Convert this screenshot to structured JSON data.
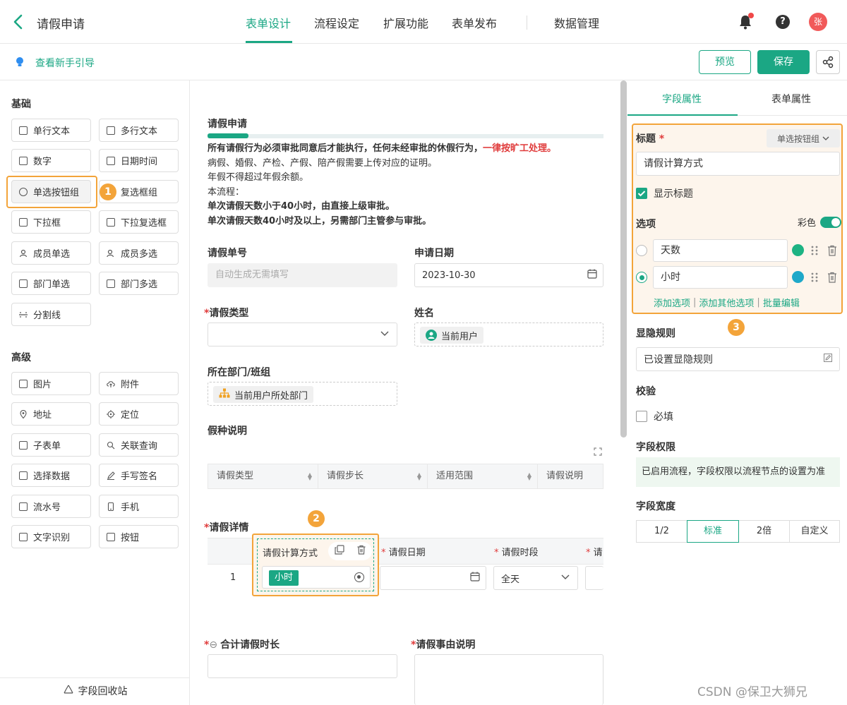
{
  "header": {
    "back_icon": "chevron-left-icon",
    "title": "请假申请",
    "nav": [
      "表单设计",
      "流程设定",
      "扩展功能",
      "表单发布",
      "数据管理"
    ],
    "active_nav": "表单设计",
    "help_label": "?",
    "avatar_label": "张"
  },
  "toolbar": {
    "guide_label": "查看新手引导",
    "preview_label": "预览",
    "save_label": "保存"
  },
  "left_panel": {
    "basic_title": "基础",
    "basic_items": [
      "单行文本",
      "多行文本",
      "数字",
      "日期时间",
      "单选按钮组",
      "复选框组",
      "下拉框",
      "下拉复选框",
      "成员单选",
      "成员多选",
      "部门单选",
      "部门多选",
      "分割线"
    ],
    "advanced_title": "高级",
    "advanced_items": [
      "图片",
      "附件",
      "地址",
      "定位",
      "子表单",
      "关联查询",
      "选择数据",
      "手写签名",
      "流水号",
      "手机",
      "文字识别",
      "按钮"
    ],
    "recycle_label": "字段回收站"
  },
  "badges": {
    "one": "1",
    "two": "2",
    "three": "3"
  },
  "form": {
    "title": "请假申请",
    "note": {
      "line1_bold": "所有请假行为必须审批同意后才能执行，任何未经审批的休假行为，",
      "line1_red": "一律按旷工处理。",
      "line2": "病假、婚假、产检、产假、陪产假需要上传对应的证明。",
      "line3": "年假不得超过年假余额。",
      "line4": "本流程：",
      "line5": "单次请假天数小于40小时，由直接上级审批。",
      "line6": "单次请假天数40小时及以上，另需部门主管参与审批。"
    },
    "order_no_label": "请假单号",
    "order_no_placeholder": "自动生成无需填写",
    "apply_date_label": "申请日期",
    "apply_date_value": "2023-10-30",
    "leave_type_label": "请假类型",
    "name_label": "姓名",
    "name_chip": "当前用户",
    "dept_label": "所在部门/班组",
    "dept_chip": "当前用户所处部门",
    "leave_desc_label": "假种说明",
    "desc_table_headers": [
      "请假类型",
      "请假步长",
      "适用范围",
      "请假说明"
    ],
    "detail_label": "请假详情",
    "detail_headers": [
      "请假计算方式",
      "请假日期",
      "请假时段",
      "请"
    ],
    "detail_row": {
      "index": "1",
      "calc": "小时",
      "period": "全天"
    },
    "total_label": "合计请假时长",
    "reason_label": "请假事由说明"
  },
  "right_panel": {
    "tabs": [
      "字段属性",
      "表单属性"
    ],
    "active_tab": "字段属性",
    "title_label": "标题",
    "type_select": "单选按钮组",
    "title_value": "请假计算方式",
    "show_title_label": "显示标题",
    "options_label": "选项",
    "color_label": "彩色",
    "options": [
      {
        "label": "天数",
        "color": "#1db383",
        "selected": false
      },
      {
        "label": "小时",
        "color": "#1ea8c9",
        "selected": true
      }
    ],
    "add_option": "添加选项",
    "add_other": "添加其他选项",
    "batch_edit": "批量编辑",
    "visibility_label": "显隐规则",
    "visibility_value": "已设置显隐规则",
    "validation_label": "校验",
    "required_label": "必填",
    "permission_label": "字段权限",
    "permission_text": "已启用流程，字段权限以流程节点的设置为准",
    "width_label": "字段宽度",
    "width_options": [
      "1/2",
      "标准",
      "2倍",
      "自定义"
    ],
    "width_active": "标准"
  },
  "watermark": "CSDN @保卫大狮兄",
  "colors": {
    "accent": "#1ba784",
    "highlight": "#f3a43a",
    "danger": "#e03b3b"
  }
}
